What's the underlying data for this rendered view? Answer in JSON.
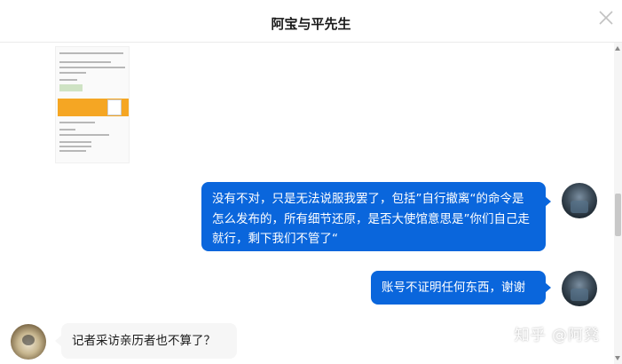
{
  "header": {
    "title": "阿宝与平先生",
    "close_icon": "close-icon"
  },
  "messages": [
    {
      "direction": "out",
      "text": "没有不对，只是无法说服我罢了，包括”自行撤离“的命令是怎么发布的，所有细节还原，是否大使馆意思是”你们自己走就行，剩下我们不管了“"
    },
    {
      "direction": "out",
      "text": "账号不证明任何东西，谢谢"
    },
    {
      "direction": "in",
      "text": "记者采访亲历者也不算了？"
    }
  ],
  "watermark": "知乎 @阿凳",
  "colors": {
    "outgoing_bubble": "#0a66dc",
    "incoming_bubble": "#f6f6f6",
    "header_border": "#ebebeb"
  }
}
